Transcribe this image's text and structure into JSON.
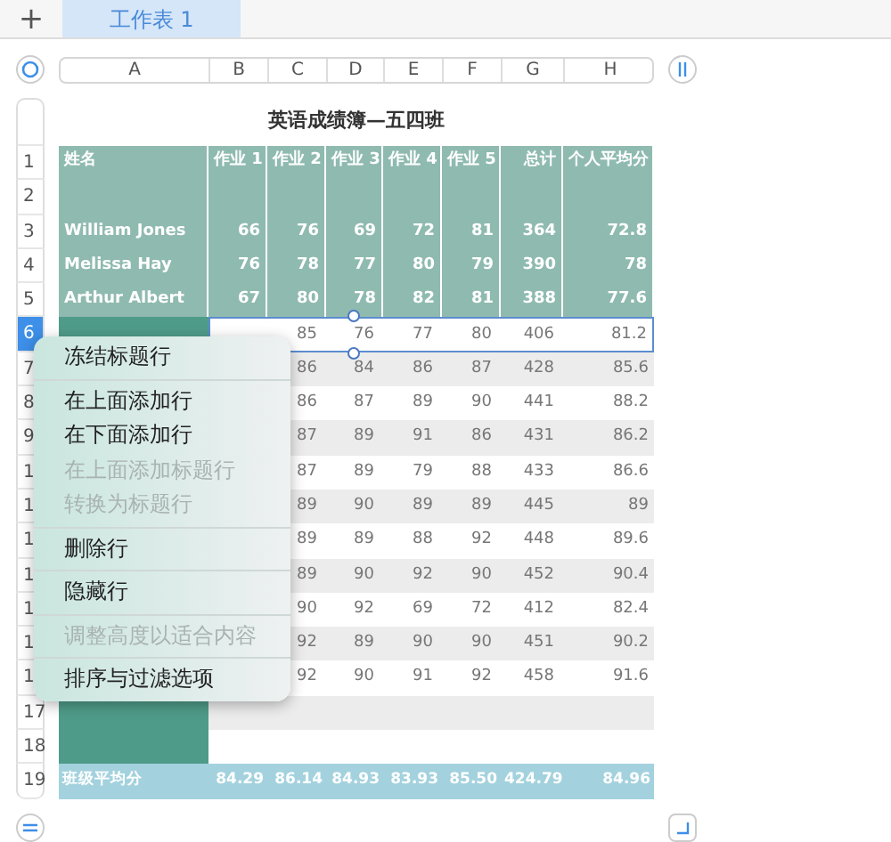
{
  "tab_bar": {
    "add_button": "+",
    "tabs": [
      {
        "label": "工作表 1",
        "selected": true
      }
    ]
  },
  "column_headers": [
    "A",
    "B",
    "C",
    "D",
    "E",
    "F",
    "G",
    "H"
  ],
  "title": "英语成绩簿—五四班",
  "rows": [
    {
      "number": "1",
      "kind": "header",
      "selected": false,
      "cells": [
        "姓名",
        "作业 1",
        "作业 2",
        "作业 3",
        "作业 4",
        "作业 5",
        "总计",
        "个人平均分"
      ]
    },
    {
      "number": "2",
      "kind": "header",
      "selected": false,
      "cells": [
        null,
        null,
        null,
        null,
        null,
        null,
        null,
        null
      ]
    },
    {
      "number": "3",
      "kind": "header",
      "selected": false,
      "cells": [
        "William Jones",
        "66",
        "76",
        "69",
        "72",
        "81",
        "364",
        "72.8"
      ]
    },
    {
      "number": "4",
      "kind": "header",
      "selected": false,
      "cells": [
        "Melissa Hay",
        "76",
        "78",
        "77",
        "80",
        "79",
        "390",
        "78"
      ]
    },
    {
      "number": "5",
      "kind": "header",
      "selected": false,
      "cells": [
        "Arthur Albert",
        "67",
        "80",
        "78",
        "82",
        "81",
        "388",
        "77.6"
      ]
    },
    {
      "number": "6",
      "kind": "body",
      "selected": true,
      "cells": [
        null,
        null,
        "85",
        "76",
        "77",
        "80",
        "406",
        "81.2"
      ]
    },
    {
      "number": "7",
      "kind": "body",
      "selected": false,
      "cells": [
        null,
        null,
        "86",
        "84",
        "86",
        "87",
        "428",
        "85.6"
      ]
    },
    {
      "number": "8",
      "kind": "body",
      "selected": false,
      "cells": [
        null,
        null,
        "86",
        "87",
        "89",
        "90",
        "441",
        "88.2"
      ]
    },
    {
      "number": "9",
      "kind": "body",
      "selected": false,
      "cells": [
        null,
        null,
        "87",
        "89",
        "91",
        "86",
        "431",
        "86.2"
      ]
    },
    {
      "number": "1",
      "kind": "body",
      "selected": false,
      "cells": [
        null,
        null,
        "87",
        "89",
        "79",
        "88",
        "433",
        "86.6"
      ]
    },
    {
      "number": "1",
      "kind": "body",
      "selected": false,
      "cells": [
        null,
        null,
        "89",
        "90",
        "89",
        "89",
        "445",
        "89"
      ]
    },
    {
      "number": "1",
      "kind": "body",
      "selected": false,
      "cells": [
        null,
        null,
        "89",
        "89",
        "88",
        "92",
        "448",
        "89.6"
      ]
    },
    {
      "number": "1",
      "kind": "body",
      "selected": false,
      "cells": [
        null,
        null,
        "89",
        "90",
        "92",
        "90",
        "452",
        "90.4"
      ]
    },
    {
      "number": "1",
      "kind": "body",
      "selected": false,
      "cells": [
        null,
        null,
        "90",
        "92",
        "69",
        "72",
        "412",
        "82.4"
      ]
    },
    {
      "number": "1",
      "kind": "body",
      "selected": false,
      "cells": [
        null,
        null,
        "92",
        "89",
        "90",
        "90",
        "451",
        "90.2"
      ]
    },
    {
      "number": "1",
      "kind": "body",
      "selected": false,
      "cells": [
        null,
        null,
        "92",
        "90",
        "91",
        "92",
        "458",
        "91.6"
      ]
    },
    {
      "number": "17",
      "kind": "body",
      "selected": false,
      "cells": [
        null,
        null,
        null,
        null,
        null,
        null,
        null,
        null
      ]
    },
    {
      "number": "18",
      "kind": "body",
      "selected": false,
      "cells": [
        null,
        null,
        null,
        null,
        null,
        null,
        null,
        null
      ]
    },
    {
      "number": "19",
      "kind": "footer",
      "selected": false,
      "cells": [
        "班级平均分",
        "84.29",
        "86.14",
        "84.93",
        "83.93",
        "85.50",
        "424.79",
        "84.96"
      ]
    }
  ],
  "context_menu": {
    "groups": [
      [
        {
          "label": "冻结标题行",
          "disabled": false
        }
      ],
      [
        {
          "label": "在上面添加行",
          "disabled": false
        },
        {
          "label": "在下面添加行",
          "disabled": false
        },
        {
          "label": "在上面添加标题行",
          "disabled": true
        },
        {
          "label": "转换为标题行",
          "disabled": true
        }
      ],
      [
        {
          "label": "删除行",
          "disabled": false
        }
      ],
      [
        {
          "label": "隐藏行",
          "disabled": false
        }
      ],
      [
        {
          "label": "调整高度以适合内容",
          "disabled": true
        }
      ],
      [
        {
          "label": "排序与过滤选项",
          "disabled": false
        }
      ]
    ]
  }
}
